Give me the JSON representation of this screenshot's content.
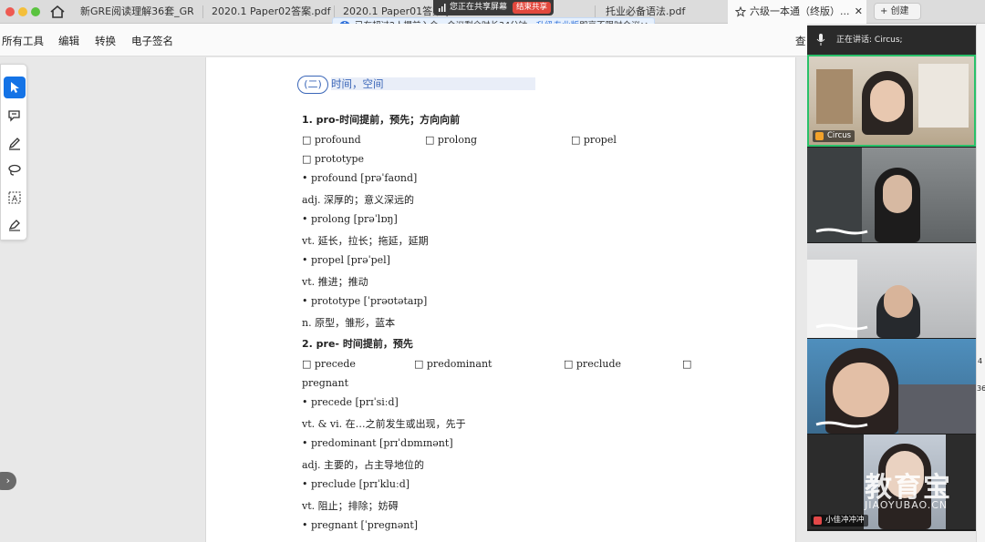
{
  "tabs": [
    {
      "label": "新GRE阅读理解36套_GR..."
    },
    {
      "label": "2020.1 Paper02答案.pdf"
    },
    {
      "label": "2020.1 Paper01答案.pdf"
    },
    {
      "label": "托业必备语法.pdf"
    },
    {
      "label": "六级一本通（终版）..."
    }
  ],
  "new_tab_label": "+ 创建",
  "share_bar": {
    "text": "您正在共享屏幕",
    "stop_label": "结束共享"
  },
  "notice": {
    "prefix": "已有超过2人提前入会，会议剩余时长34分钟。",
    "link": "升级专业版",
    "suffix": "即享不限时会议"
  },
  "menu": [
    "所有工具",
    "编辑",
    "转换",
    "电子签名"
  ],
  "menu_search": "查",
  "tools": [
    "cursor-icon",
    "comment-icon",
    "pen-icon",
    "lasso-icon",
    "text-select-icon",
    "sign-icon"
  ],
  "document": {
    "section_badge": "(二)",
    "section_title": "时间，空间",
    "h1": "1. pro-时间提前，预先；方向向前",
    "row1": [
      "□ profound",
      "□ prolong",
      "□ propel"
    ],
    "row1b": "□ prototype",
    "entries1": [
      {
        "word": "• profound [prəˈfaʊnd]",
        "def": "adj.  深厚的；意义深远的"
      },
      {
        "word": "• prolong [prəˈlɒŋ]",
        "def": "vt.  延长，拉长；拖延，延期"
      },
      {
        "word": "• propel [prəˈpel]",
        "def": "vt.  推进；推动"
      },
      {
        "word": "• prototype [ˈprəʊtətaɪp]",
        "def": "n.  原型，雏形，蓝本"
      }
    ],
    "h2": "2. pre-    时间提前，预先",
    "row2": [
      "□ precede",
      "□ predominant",
      "□ preclude",
      "□"
    ],
    "row2b": "pregnant",
    "entries2": [
      {
        "word": "• precede [prɪˈsiːd]",
        "def": "vt. & vi.  在…之前发生或出现，先于"
      },
      {
        "word": "• predominant [prɪˈdɒmɪnənt]",
        "def": "adj.  主要的，占主导地位的"
      },
      {
        "word": "• preclude [prɪˈkluːd]",
        "def": "vt.  阻止；排除；妨碍"
      },
      {
        "word": "• pregnant [ˈpregnənt]",
        "def": ""
      }
    ]
  },
  "video_panel": {
    "speaking_prefix": "正在讲话:",
    "speaking_name": "Circus;",
    "participants": [
      {
        "name": "Circus"
      },
      {
        "name": ""
      },
      {
        "name": ""
      },
      {
        "name": ""
      },
      {
        "name": "小佳冲冲冲"
      }
    ]
  },
  "watermark": {
    "cn": "教育宝",
    "en": "JIAOYUBAO.CN"
  },
  "right_strip_numbers": [
    "4",
    "36"
  ],
  "colors": {
    "accent": "#1473e6",
    "speaking_border": "#29c16a",
    "stop_share": "#e2483d",
    "section_blue": "#3a66b8"
  }
}
